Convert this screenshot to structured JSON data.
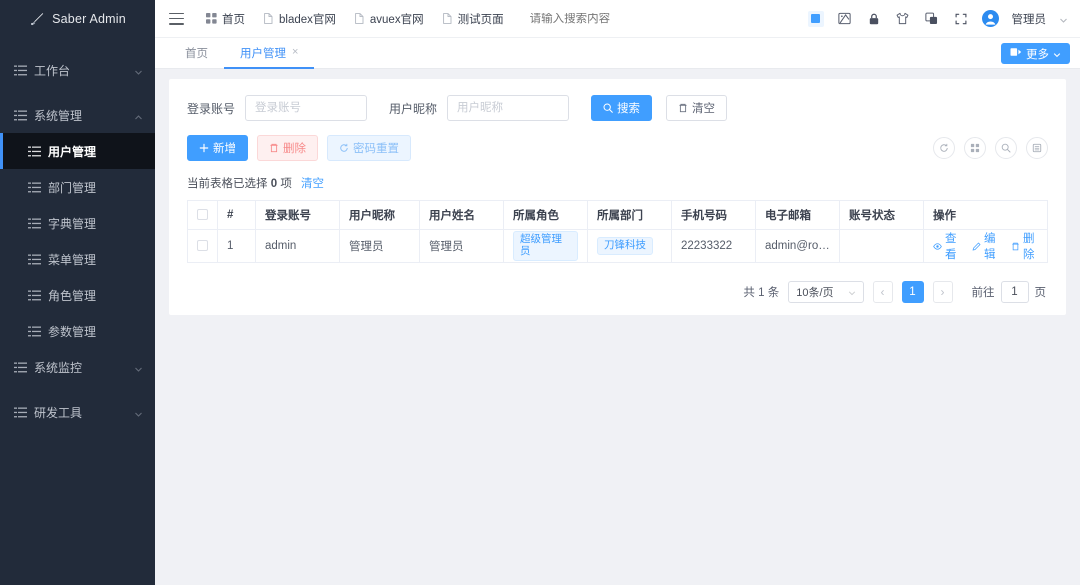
{
  "sidebar": {
    "logo": {
      "icon": "saber-icon",
      "text": "Saber Admin"
    },
    "items": [
      {
        "label": "工作台",
        "icon": "menu-list-icon",
        "arrow": "chevron-down-icon",
        "expanded": false
      },
      {
        "label": "系统管理",
        "icon": "menu-list-icon",
        "arrow": "chevron-up-icon",
        "expanded": true
      },
      {
        "label": "系统监控",
        "icon": "menu-list-icon",
        "arrow": "chevron-down-icon",
        "expanded": false
      },
      {
        "label": "研发工具",
        "icon": "menu-list-icon",
        "arrow": "chevron-down-icon",
        "expanded": false
      }
    ],
    "submenu": [
      {
        "label": "用户管理",
        "icon": "menu-list-icon",
        "active": true
      },
      {
        "label": "部门管理",
        "icon": "menu-list-icon",
        "active": false
      },
      {
        "label": "字典管理",
        "icon": "menu-list-icon",
        "active": false
      },
      {
        "label": "菜单管理",
        "icon": "menu-list-icon",
        "active": false
      },
      {
        "label": "角色管理",
        "icon": "menu-list-icon",
        "active": false
      },
      {
        "label": "参数管理",
        "icon": "menu-list-icon",
        "active": false
      }
    ],
    "accent_color": "#4091f7",
    "bg_color": "#222b3a",
    "active_bg_color": "#0f131a"
  },
  "topbar": {
    "hamburger": "hamburger-icon",
    "nav": [
      {
        "label": "首页",
        "icon": "grid-icon"
      },
      {
        "label": "bladex官网",
        "icon": "file-icon"
      },
      {
        "label": "avuex官网",
        "icon": "file-icon"
      },
      {
        "label": "测试页面",
        "icon": "file-icon"
      }
    ],
    "search_placeholder": "请输入搜索内容",
    "tools": [
      {
        "name": "color-swatch-icon",
        "color": "#409eff"
      },
      {
        "name": "screenshot-icon"
      },
      {
        "name": "lock-icon"
      },
      {
        "name": "theme-shirt-icon"
      },
      {
        "name": "layers-icon"
      },
      {
        "name": "fullscreen-icon"
      }
    ],
    "user": {
      "avatar": "avatar-icon",
      "name": "管理员",
      "caret": "chevron-down-icon"
    }
  },
  "tabbar": {
    "tabs": [
      {
        "label": "首页",
        "active": false,
        "closable": false
      },
      {
        "label": "用户管理",
        "active": true,
        "closable": true,
        "close": "×"
      }
    ],
    "more_button": {
      "label": "更多",
      "icon": "more-icon",
      "caret": "chevron-down-icon"
    }
  },
  "search_form": {
    "fields": [
      {
        "label": "登录账号",
        "value": "",
        "placeholder": "登录账号",
        "name": "account"
      },
      {
        "label": "用户昵称",
        "value": "",
        "placeholder": "用户昵称",
        "name": "nickname"
      }
    ],
    "search_button": {
      "label": "搜索",
      "icon": "search-icon"
    },
    "clear_button": {
      "label": "清空",
      "icon": "trash-icon"
    }
  },
  "toolbar": {
    "add_label": "新增",
    "delete_label": "删除",
    "reset_label": "密码重置",
    "round_tools": [
      {
        "name": "refresh-icon"
      },
      {
        "name": "columns-icon"
      },
      {
        "name": "search-icon"
      },
      {
        "name": "filter-list-icon"
      }
    ]
  },
  "selection": {
    "prefix": "当前表格已选择",
    "count": "0",
    "suffix": "项",
    "clear_label": "清空"
  },
  "table": {
    "columns": [
      "#",
      "登录账号",
      "用户昵称",
      "用户姓名",
      "所属角色",
      "所属部门",
      "手机号码",
      "电子邮箱",
      "账号状态",
      "操作"
    ],
    "rows": [
      {
        "index": "1",
        "account": "admin",
        "nickname": "管理员",
        "realname": "管理员",
        "role": "超级管理员",
        "dept": "刀锋科技",
        "phone": "22233322",
        "email": "admin@ronris...",
        "status": ""
      }
    ],
    "ops": [
      {
        "label": "查看",
        "icon": "eye-icon"
      },
      {
        "label": "编辑",
        "icon": "pencil-icon"
      },
      {
        "label": "删除",
        "icon": "trash-icon"
      }
    ]
  },
  "pagination": {
    "total_text": "共 1 条",
    "page_size": "10条/页",
    "prev": "‹",
    "next": "›",
    "current_page": "1",
    "jump_prefix": "前往",
    "jump_value": "1",
    "jump_suffix": "页"
  }
}
